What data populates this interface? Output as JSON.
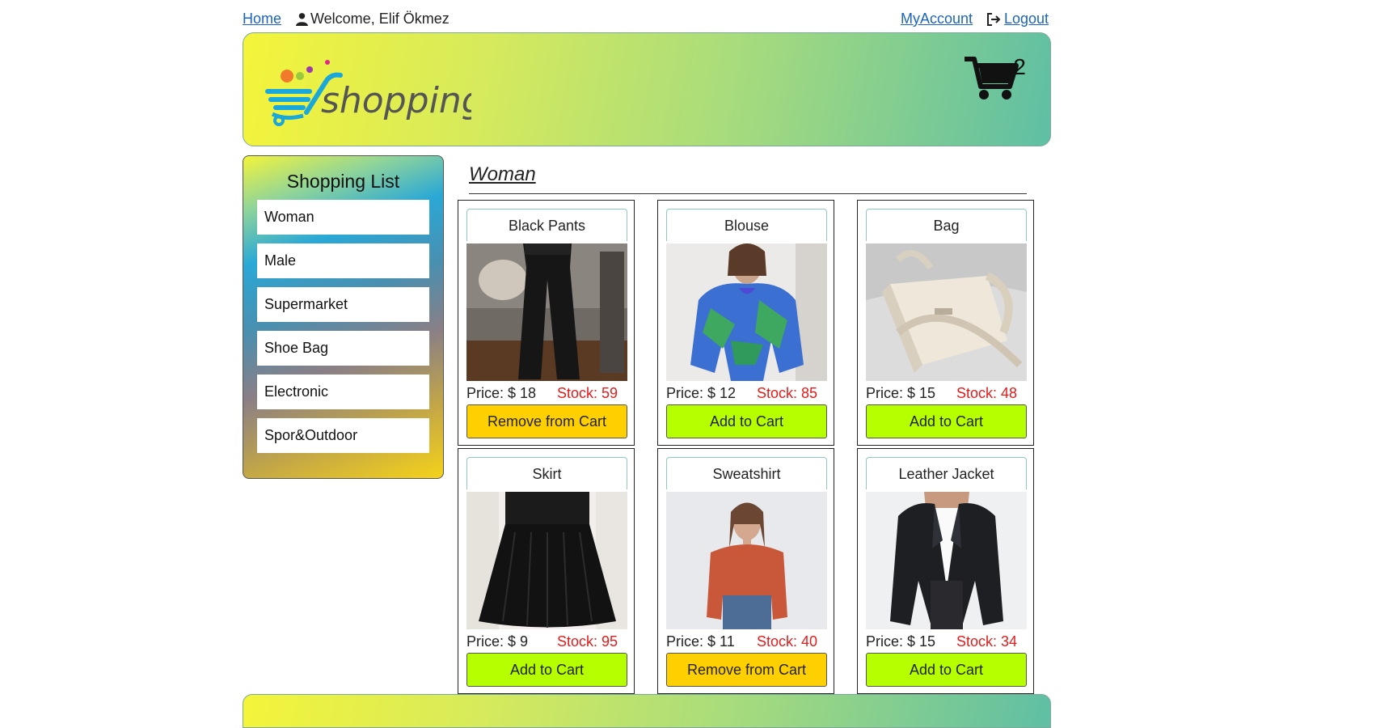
{
  "topbar": {
    "home": "Home",
    "welcome": "Welcome, Elif Ökmez",
    "my_account": "MyAccount",
    "logout": "Logout"
  },
  "header": {
    "logo_text": "shopping",
    "cart_count": "2"
  },
  "sidebar": {
    "title": "Shopping List",
    "items": [
      {
        "label": "Woman"
      },
      {
        "label": "Male"
      },
      {
        "label": "Supermarket"
      },
      {
        "label": "Shoe Bag"
      },
      {
        "label": "Electronic"
      },
      {
        "label": "Spor&Outdoor"
      }
    ]
  },
  "category": {
    "title": "Woman"
  },
  "products": [
    {
      "name": "Black Pants",
      "price": "Price: $ 18",
      "stock": "Stock: 59",
      "button": "Remove from Cart",
      "in_cart": true
    },
    {
      "name": "Blouse",
      "price": "Price: $ 12",
      "stock": "Stock: 85",
      "button": "Add to Cart",
      "in_cart": false
    },
    {
      "name": "Bag",
      "price": "Price: $ 15",
      "stock": "Stock: 48",
      "button": "Add to Cart",
      "in_cart": false
    },
    {
      "name": "Skirt",
      "price": "Price: $ 9",
      "stock": "Stock: 95",
      "button": "Add to Cart",
      "in_cart": false
    },
    {
      "name": "Sweatshirt",
      "price": "Price: $ 11",
      "stock": "Stock: 40",
      "button": "Remove from Cart",
      "in_cart": true
    },
    {
      "name": "Leather Jacket",
      "price": "Price: $ 15",
      "stock": "Stock: 34",
      "button": "Add to Cart",
      "in_cart": false
    }
  ],
  "colors": {
    "add_button": "#b5ff00",
    "remove_button": "#ffd000",
    "stock_text": "#e41b1b",
    "link": "#1a64c2"
  },
  "icons": [
    "user-icon",
    "logout-icon",
    "cart-icon",
    "logo-cart-icon"
  ]
}
